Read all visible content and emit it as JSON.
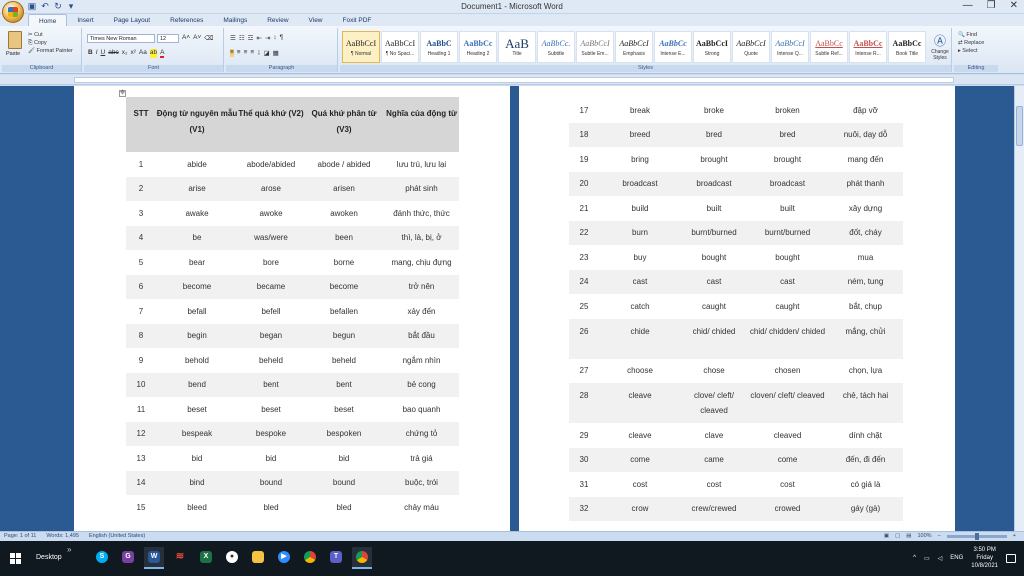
{
  "window": {
    "title": "Document1 - Microsoft Word"
  },
  "tabs": [
    "Home",
    "Insert",
    "Page Layout",
    "References",
    "Mailings",
    "Review",
    "View",
    "Foxit PDF"
  ],
  "ribbon": {
    "clipboard": {
      "paste": "Paste",
      "cut": "Cut",
      "copy": "Copy",
      "format_painter": "Format Painter",
      "label": "Clipboard"
    },
    "font": {
      "name": "Times New Roman",
      "size": "12",
      "label": "Font"
    },
    "paragraph": {
      "label": "Paragraph"
    },
    "styles": {
      "label": "Styles",
      "items": [
        {
          "sample": "AaBbCcI",
          "name": "¶ Normal"
        },
        {
          "sample": "AaBbCcI",
          "name": "¶ No Spaci..."
        },
        {
          "sample": "AaBbC",
          "name": "Heading 1"
        },
        {
          "sample": "AaBbCc",
          "name": "Heading 2"
        },
        {
          "sample": "AaB",
          "name": "Title"
        },
        {
          "sample": "AaBbCc.",
          "name": "Subtitle"
        },
        {
          "sample": "AaBbCcI",
          "name": "Subtle Em..."
        },
        {
          "sample": "AaBbCcI",
          "name": "Emphasis"
        },
        {
          "sample": "AaBbCc",
          "name": "Intense E..."
        },
        {
          "sample": "AaBbCcI",
          "name": "Strong"
        },
        {
          "sample": "AaBbCcI",
          "name": "Quote"
        },
        {
          "sample": "AaBbCcI",
          "name": "Intense Q..."
        },
        {
          "sample": "AaBbCc",
          "name": "Subtle Ref..."
        },
        {
          "sample": "AaBbCc",
          "name": "Intense R..."
        },
        {
          "sample": "AaBbCc",
          "name": "Book Title"
        }
      ],
      "change_styles": "Change Styles"
    },
    "editing": {
      "find": "Find",
      "replace": "Replace",
      "select": "Select",
      "label": "Editing"
    }
  },
  "table1": {
    "headers": [
      "STT",
      "Động từ nguyên mẫu (V1)",
      "Thể quá khứ (V2)",
      "Quá khứ phân từ (V3)",
      "Nghĩa của động từ"
    ],
    "rows": [
      [
        "1",
        "abide",
        "abode/abided",
        "abode / abided",
        "lưu trú, lưu lại"
      ],
      [
        "2",
        "arise",
        "arose",
        "arisen",
        "phát sinh"
      ],
      [
        "3",
        "awake",
        "awoke",
        "awoken",
        "đánh thức, thức"
      ],
      [
        "4",
        "be",
        "was/were",
        "been",
        "thì, là, bị, ở"
      ],
      [
        "5",
        "bear",
        "bore",
        "borne",
        "mang, chịu đựng"
      ],
      [
        "6",
        "become",
        "became",
        "become",
        "trở nên"
      ],
      [
        "7",
        "befall",
        "befell",
        "befallen",
        "xảy đến"
      ],
      [
        "8",
        "begin",
        "began",
        "begun",
        "bắt đầu"
      ],
      [
        "9",
        "behold",
        "beheld",
        "beheld",
        "ngắm nhìn"
      ],
      [
        "10",
        "bend",
        "bent",
        "bent",
        "bẻ cong"
      ],
      [
        "11",
        "beset",
        "beset",
        "beset",
        "bao quanh"
      ],
      [
        "12",
        "bespeak",
        "bespoke",
        "bespoken",
        "chứng tỏ"
      ],
      [
        "13",
        "bid",
        "bid",
        "bid",
        "trả giá"
      ],
      [
        "14",
        "bind",
        "bound",
        "bound",
        "buộc, trói"
      ],
      [
        "15",
        "bleed",
        "bled",
        "bled",
        "chảy máu"
      ]
    ]
  },
  "table2": {
    "rows": [
      [
        "17",
        "break",
        "broke",
        "broken",
        "đập vỡ"
      ],
      [
        "18",
        "breed",
        "bred",
        "bred",
        "nuôi, dạy dỗ"
      ],
      [
        "19",
        "bring",
        "brought",
        "brought",
        "mang đến"
      ],
      [
        "20",
        "broadcast",
        "broadcast",
        "broadcast",
        "phát thanh"
      ],
      [
        "21",
        "build",
        "built",
        "built",
        "xây dựng"
      ],
      [
        "22",
        "burn",
        "burnt/burned",
        "burnt/burned",
        "đốt, cháy"
      ],
      [
        "23",
        "buy",
        "bought",
        "bought",
        "mua"
      ],
      [
        "24",
        "cast",
        "cast",
        "cast",
        "ném, tung"
      ],
      [
        "25",
        "catch",
        "caught",
        "caught",
        "bắt, chụp"
      ],
      [
        "26",
        "chide",
        "chid/ chided",
        "chid/ chidden/ chided",
        "mắng, chửi"
      ],
      [
        "27",
        "choose",
        "chose",
        "chosen",
        "chọn, lựa"
      ],
      [
        "28",
        "cleave",
        "clove/ cleft/ cleaved",
        "cloven/ cleft/ cleaved",
        "chẻ, tách hai"
      ],
      [
        "29",
        "cleave",
        "clave",
        "cleaved",
        "dính chặt"
      ],
      [
        "30",
        "come",
        "came",
        "come",
        "đến, đi đến"
      ],
      [
        "31",
        "cost",
        "cost",
        "cost",
        "có giá là"
      ],
      [
        "32",
        "crow",
        "crew/crewed",
        "crowed",
        "gáy (gà)"
      ]
    ]
  },
  "status": {
    "page": "Page: 1 of 11",
    "words": "Words: 1,495",
    "language": "English (United States)",
    "zoom": "100%"
  },
  "taskbar": {
    "desktop": "Desktop",
    "tray": {
      "lang": "ENG",
      "time": "3:50 PM",
      "day": "Friday",
      "date": "10/8/2021"
    }
  }
}
